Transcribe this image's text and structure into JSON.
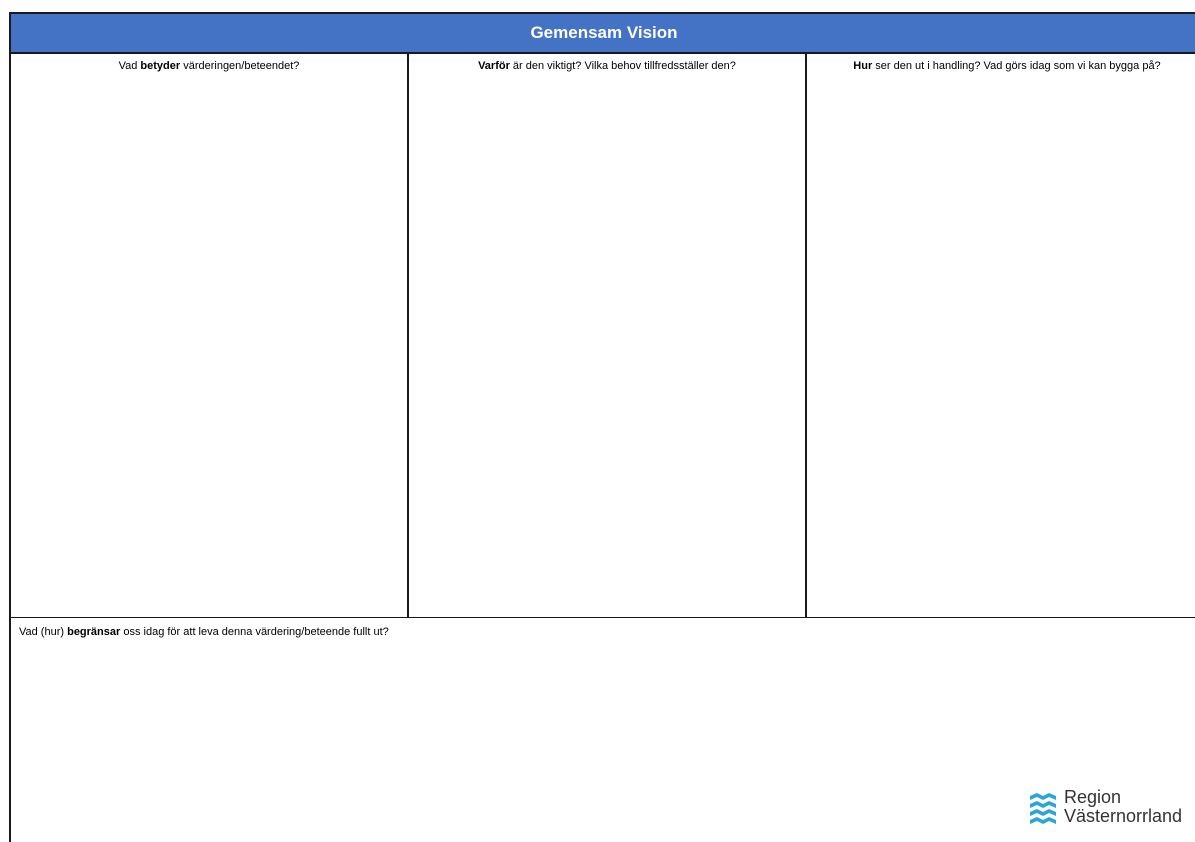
{
  "header": {
    "title": "Gemensam Vision"
  },
  "columns": [
    {
      "bold": "",
      "pre": "Vad ",
      "bold_word": "betyder",
      "post": " värderingen/beteendet?"
    },
    {
      "pre": "",
      "bold_word": "Varför",
      "post": " är den viktigt? Vilka behov tillfredsställer den?"
    },
    {
      "pre": "",
      "bold_word": "Hur",
      "post": " ser den ut i handling? Vad görs idag som vi kan bygga på?"
    }
  ],
  "bottom": {
    "pre": "Vad (hur) ",
    "bold_word": "begränsar",
    "post": " oss idag för att leva denna värdering/beteende fullt ut?"
  },
  "logo": {
    "line1": "Region",
    "line2": "Västernorrland",
    "icon": "waves-logo-icon",
    "color": "#2ba4d9"
  },
  "colors": {
    "header_bg": "#4472c4",
    "header_text": "#ffffff"
  }
}
